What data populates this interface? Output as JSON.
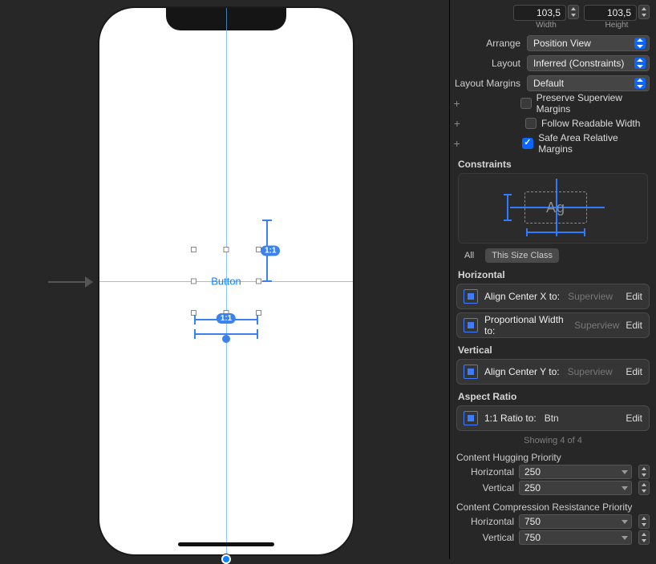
{
  "size": {
    "width": "103,5",
    "height": "103,5",
    "widthLabel": "Width",
    "heightLabel": "Height"
  },
  "arrange": {
    "label": "Arrange",
    "value": "Position View"
  },
  "layout": {
    "label": "Layout",
    "value": "Inferred (Constraints)"
  },
  "margins": {
    "label": "Layout Margins",
    "value": "Default",
    "preserve": "Preserve Superview Margins",
    "follow": "Follow Readable Width",
    "safe": "Safe Area Relative Margins"
  },
  "constraints": {
    "title": "Constraints",
    "diagramText": "Ag",
    "tabAll": "All",
    "tabThis": "This Size Class"
  },
  "horizontal": {
    "title": "Horizontal",
    "centerX": {
      "text": "Align Center X to:",
      "placeholder": "Superview",
      "edit": "Edit"
    },
    "propW": {
      "text": "Proportional Width to:",
      "placeholder": "Superview",
      "edit": "Edit"
    }
  },
  "vertical": {
    "title": "Vertical",
    "centerY": {
      "text": "Align Center Y to:",
      "placeholder": "Superview",
      "edit": "Edit"
    }
  },
  "aspect": {
    "title": "Aspect Ratio",
    "ratio": {
      "text": "1:1 Ratio to:",
      "value": "Btn",
      "edit": "Edit"
    }
  },
  "showing": "Showing 4 of 4",
  "hugging": {
    "title": "Content Hugging Priority",
    "hLabel": "Horizontal",
    "hVal": "250",
    "vLabel": "Vertical",
    "vVal": "250"
  },
  "compress": {
    "title": "Content Compression Resistance Priority",
    "hLabel": "Horizontal",
    "hVal": "750",
    "vLabel": "Vertical",
    "vVal": "750"
  },
  "canvas": {
    "buttonLabel": "Button",
    "badge": "1:1"
  }
}
